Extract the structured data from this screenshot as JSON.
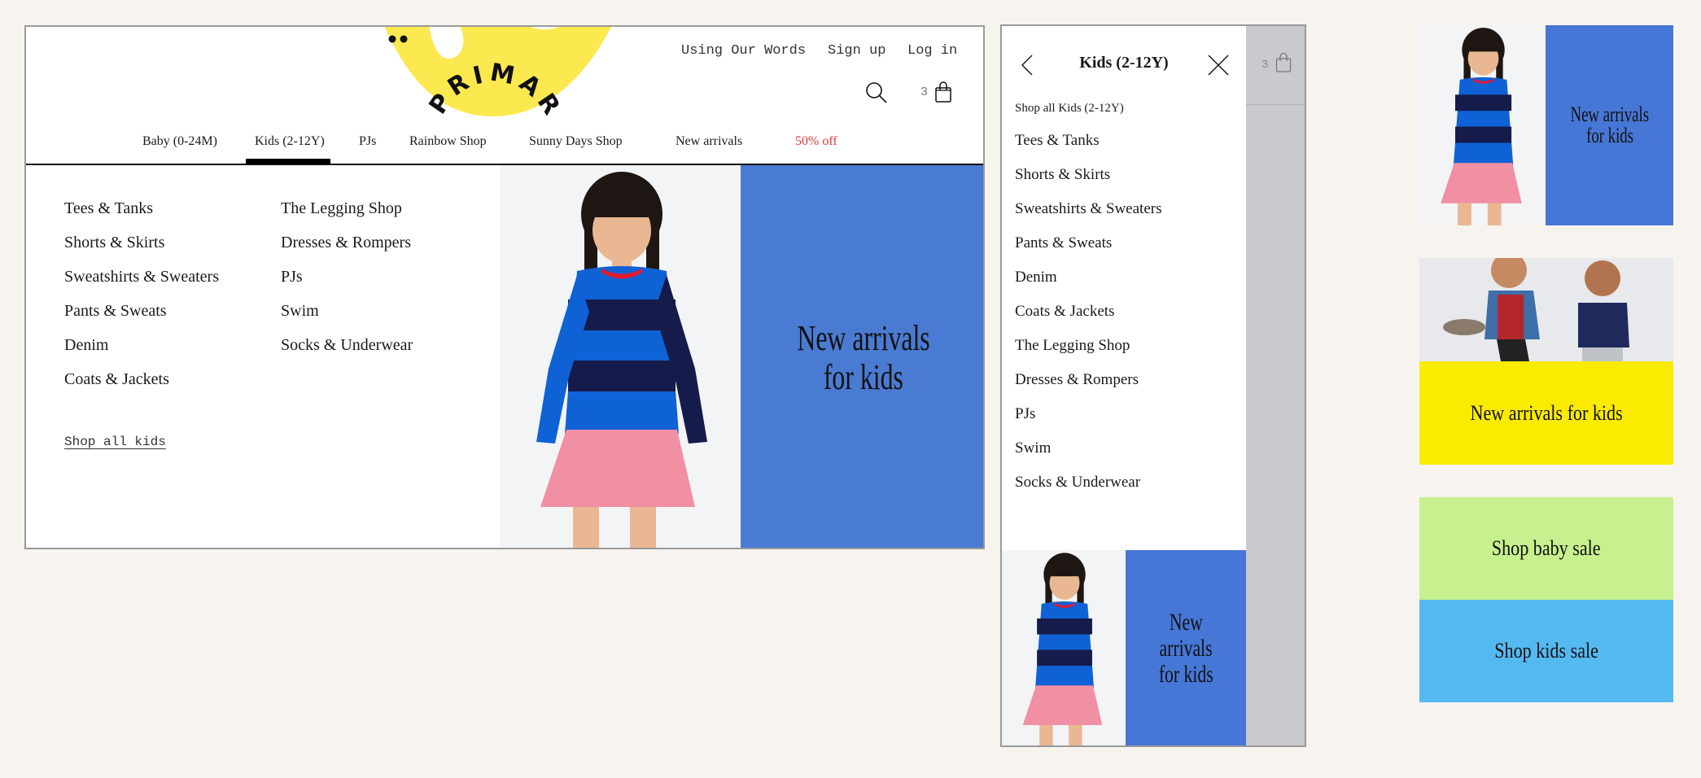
{
  "brand": {
    "name": "PRIMARY",
    "logo_color": "#fce94f"
  },
  "desktop": {
    "utility_links": [
      "Using Our Words",
      "Sign up",
      "Log in"
    ],
    "cart_count": "3",
    "nav": [
      {
        "label": "Baby (0-24M)",
        "active": false
      },
      {
        "label": "Kids (2-12Y)",
        "active": true
      },
      {
        "label": "PJs",
        "active": false
      },
      {
        "label": "Rainbow Shop",
        "active": false
      },
      {
        "label": "Sunny Days Shop",
        "active": false
      },
      {
        "label": "New arrivals",
        "active": false
      },
      {
        "label": "50% off",
        "active": false,
        "color": "#e2383c"
      }
    ],
    "mega_menu": {
      "column1": [
        "Tees & Tanks",
        "Shorts & Skirts",
        "Sweatshirts & Sweaters",
        "Pants & Sweats",
        "Denim",
        "Coats & Jackets"
      ],
      "column2": [
        "The Legging Shop",
        "Dresses & Rompers",
        "PJs",
        "Swim",
        "Socks & Underwear"
      ],
      "shop_all": "Shop all kids",
      "promo": {
        "line1": "New arrivals",
        "line2": "for kids",
        "color": "#4a7bd2"
      }
    }
  },
  "mobile": {
    "title": "Kids (2-12Y)",
    "shop_all": "Shop all Kids (2-12Y)",
    "items": [
      "Tees & Tanks",
      "Shorts & Skirts",
      "Sweatshirts & Sweaters",
      "Pants & Sweats",
      "Denim",
      "Coats & Jackets",
      "The Legging Shop",
      "Dresses & Rompers",
      "PJs",
      "Swim",
      "Socks & Underwear"
    ],
    "cart_count": "3",
    "promo": {
      "line1": "New",
      "line2": "arrivals",
      "line3": "for kids",
      "color": "#4677d6"
    }
  },
  "cards": [
    {
      "label_line1": "New arrivals",
      "label_line2": "for kids",
      "color": "#4677d6"
    },
    {
      "label": "New arrivals for kids",
      "color": "#fbeb00"
    },
    {
      "label": "Shop baby sale",
      "color": "#c7f08e"
    },
    {
      "label": "Shop kids sale",
      "color": "#55b9f1"
    }
  ]
}
